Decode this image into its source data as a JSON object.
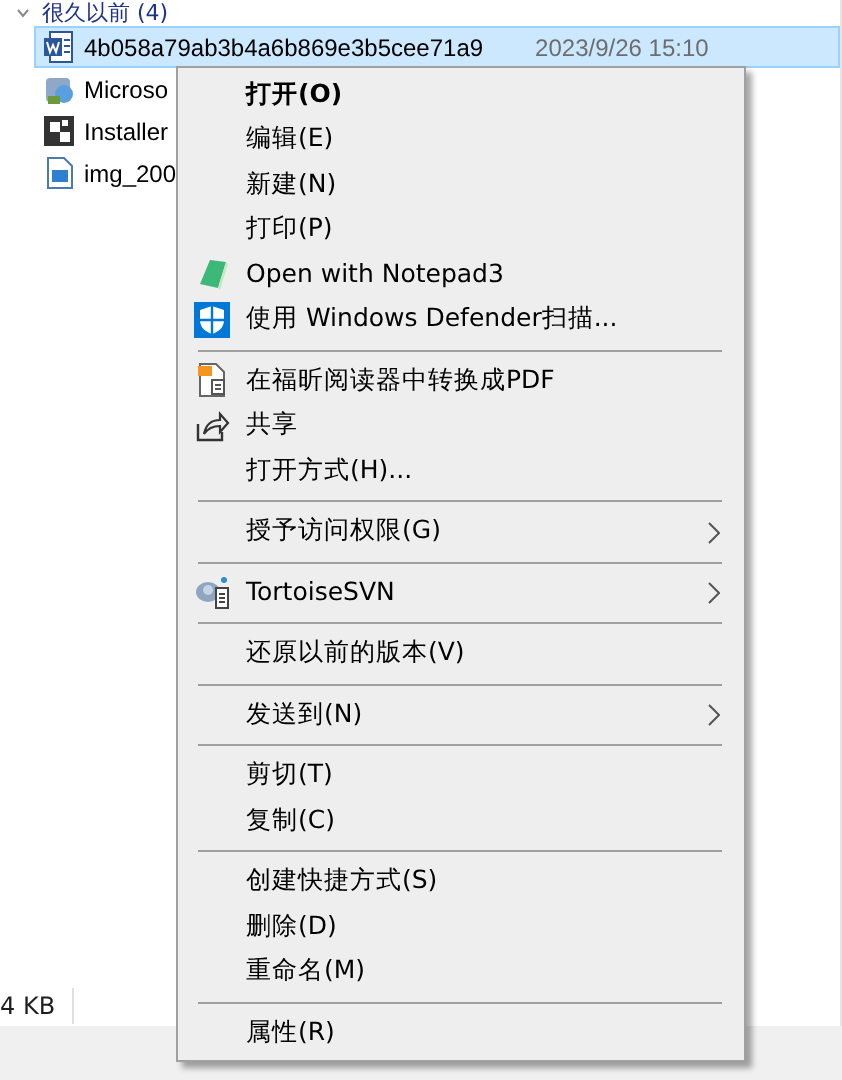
{
  "group_header": {
    "label": "很久以前 (4)"
  },
  "files": [
    {
      "kind": "document",
      "name": "4b058a79ab3b4a6b869e3b5cee71a9",
      "date": "2023/9/26 15:10",
      "selected": true
    },
    {
      "kind": "package",
      "name": "Microso",
      "selected": false
    },
    {
      "kind": "installer",
      "name": "Installer",
      "selected": false
    },
    {
      "kind": "image",
      "name": "img_200",
      "selected": false
    }
  ],
  "status_bar": {
    "size": "4 KB"
  },
  "context_menu": [
    {
      "kind": "item",
      "label": "打开(O)",
      "default": true
    },
    {
      "kind": "item",
      "label": "编辑(E)"
    },
    {
      "kind": "item",
      "label": "新建(N)"
    },
    {
      "kind": "item",
      "label": "打印(P)"
    },
    {
      "kind": "notepad",
      "label": "Open with Notepad3"
    },
    {
      "kind": "shield",
      "label": "使用 Windows Defender扫描..."
    },
    {
      "kind": "separator"
    },
    {
      "kind": "pdf",
      "label": "在福昕阅读器中转换成PDF"
    },
    {
      "kind": "share",
      "label": "共享"
    },
    {
      "kind": "item",
      "label": "打开方式(H)..."
    },
    {
      "kind": "separator"
    },
    {
      "kind": "item",
      "label": "授予访问权限(G)",
      "submenu": true
    },
    {
      "kind": "separator"
    },
    {
      "kind": "svn",
      "label": "TortoiseSVN",
      "submenu": true
    },
    {
      "kind": "separator"
    },
    {
      "kind": "item",
      "label": "还原以前的版本(V)"
    },
    {
      "kind": "separator"
    },
    {
      "kind": "item",
      "label": "发送到(N)",
      "submenu": true
    },
    {
      "kind": "separator"
    },
    {
      "kind": "item",
      "label": "剪切(T)"
    },
    {
      "kind": "item",
      "label": "复制(C)"
    },
    {
      "kind": "separator"
    },
    {
      "kind": "item",
      "label": "创建快捷方式(S)"
    },
    {
      "kind": "item",
      "label": "删除(D)"
    },
    {
      "kind": "item",
      "label": "重命名(M)"
    },
    {
      "kind": "separator"
    },
    {
      "kind": "item",
      "label": "属性(R)"
    }
  ]
}
